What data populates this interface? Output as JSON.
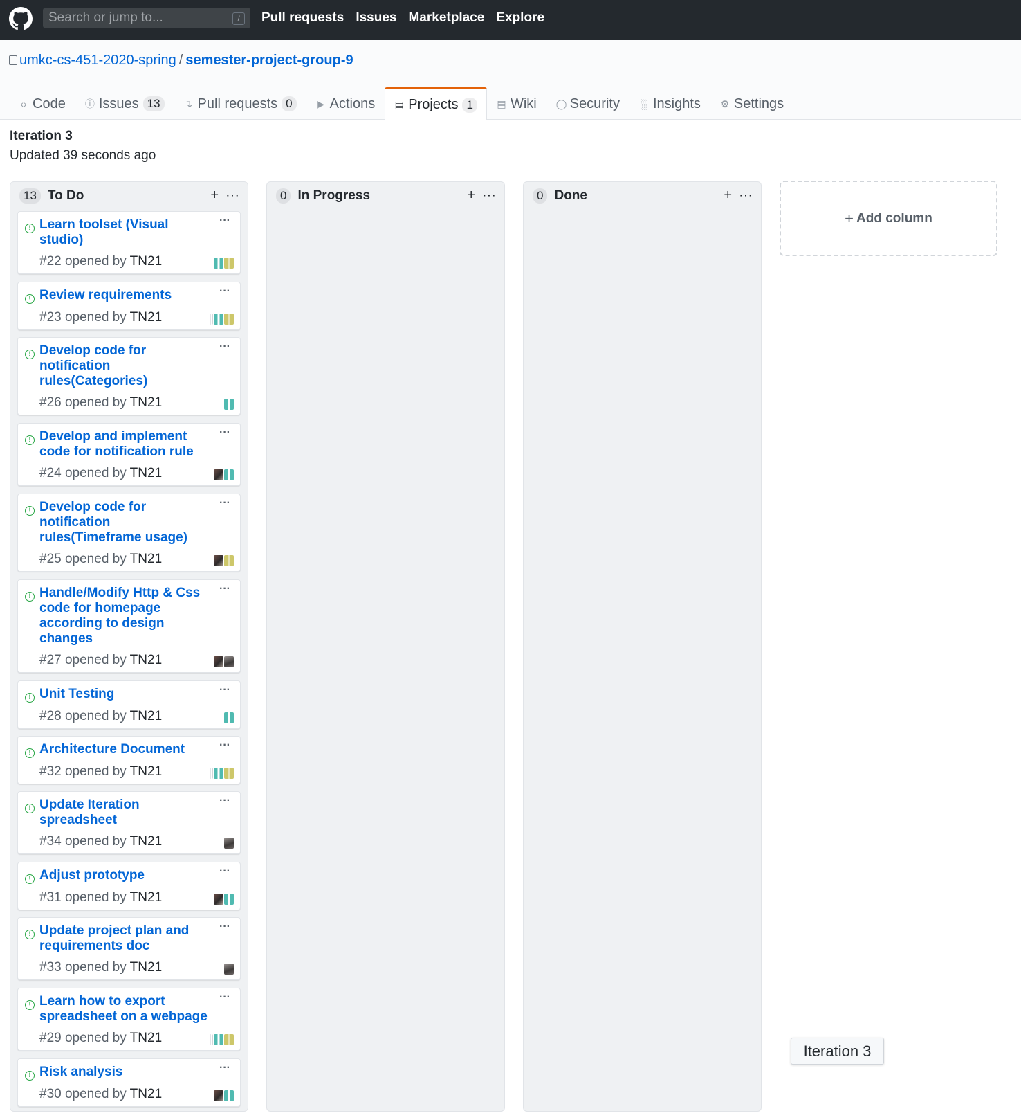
{
  "header": {
    "search_placeholder": "Search or jump to...",
    "search_shortcut": "/",
    "nav": [
      "Pull requests",
      "Issues",
      "Marketplace",
      "Explore"
    ]
  },
  "repo": {
    "owner": "umkc-cs-451-2020-spring",
    "separator": "/",
    "name": "semester-project-group-9"
  },
  "tabs": [
    {
      "label": "Code",
      "icon": "code-icon"
    },
    {
      "label": "Issues",
      "icon": "issue-icon",
      "count": "13"
    },
    {
      "label": "Pull requests",
      "icon": "pull-request-icon",
      "count": "0"
    },
    {
      "label": "Actions",
      "icon": "play-icon"
    },
    {
      "label": "Projects",
      "icon": "project-icon",
      "count": "1",
      "selected": true
    },
    {
      "label": "Wiki",
      "icon": "book-icon"
    },
    {
      "label": "Security",
      "icon": "shield-icon"
    },
    {
      "label": "Insights",
      "icon": "graph-icon"
    },
    {
      "label": "Settings",
      "icon": "gear-icon"
    }
  ],
  "project": {
    "title": "Iteration 3",
    "updated": "Updated 39 seconds ago"
  },
  "columns": [
    {
      "name": "To Do",
      "count": "13"
    },
    {
      "name": "In Progress",
      "count": "0"
    },
    {
      "name": "Done",
      "count": "0"
    }
  ],
  "column_actions": {
    "add": "+",
    "menu": "···"
  },
  "cards": [
    {
      "title": "Learn toolset (Visual studio)",
      "number": "#22",
      "opened_by": "opened by",
      "author": "TN21",
      "avatars": [
        "teal",
        "olive"
      ]
    },
    {
      "title": "Review requirements",
      "number": "#23",
      "opened_by": "opened by",
      "author": "TN21",
      "avatars": [
        "stripe",
        "teal",
        "olive"
      ]
    },
    {
      "title": "Develop code for notification rules(Categories)",
      "number": "#26",
      "opened_by": "opened by",
      "author": "TN21",
      "avatars": [
        "teal"
      ]
    },
    {
      "title": "Develop and implement code for notification rule",
      "number": "#24",
      "opened_by": "opened by",
      "author": "TN21",
      "avatars": [
        "photo",
        "teal"
      ]
    },
    {
      "title": "Develop code for notification rules(Timeframe usage)",
      "number": "#25",
      "opened_by": "opened by",
      "author": "TN21",
      "avatars": [
        "photo",
        "olive"
      ]
    },
    {
      "title": "Handle/Modify Http & Css code for homepage according to design changes",
      "number": "#27",
      "opened_by": "opened by",
      "author": "TN21",
      "avatars": [
        "photo",
        "photo2"
      ]
    },
    {
      "title": "Unit Testing",
      "number": "#28",
      "opened_by": "opened by",
      "author": "TN21",
      "avatars": [
        "teal"
      ]
    },
    {
      "title": "Architecture Document",
      "number": "#32",
      "opened_by": "opened by",
      "author": "TN21",
      "avatars": [
        "stripe",
        "teal",
        "olive"
      ]
    },
    {
      "title": "Update Iteration spreadsheet",
      "number": "#34",
      "opened_by": "opened by",
      "author": "TN21",
      "avatars": [
        "photo2"
      ]
    },
    {
      "title": "Adjust prototype",
      "number": "#31",
      "opened_by": "opened by",
      "author": "TN21",
      "avatars": [
        "photo",
        "teal"
      ]
    },
    {
      "title": "Update project plan and requirements doc",
      "number": "#33",
      "opened_by": "opened by",
      "author": "TN21",
      "avatars": [
        "photo2"
      ]
    },
    {
      "title": "Learn how to export spreadsheet on a webpage",
      "number": "#29",
      "opened_by": "opened by",
      "author": "TN21",
      "avatars": [
        "stripe",
        "teal",
        "olive"
      ]
    },
    {
      "title": "Risk analysis",
      "number": "#30",
      "opened_by": "opened by",
      "author": "TN21",
      "avatars": [
        "photo",
        "teal"
      ]
    }
  ],
  "card_menu": "···",
  "add_column": {
    "icon": "+",
    "label": "Add column"
  },
  "tooltip": "Iteration 3"
}
